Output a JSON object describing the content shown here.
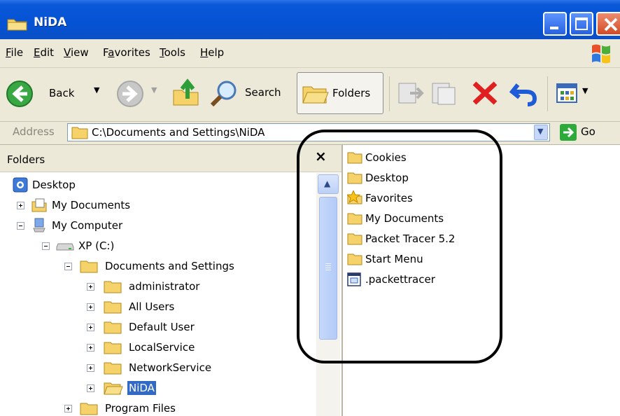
{
  "window": {
    "title": "NiDA"
  },
  "menu": {
    "items": [
      {
        "label": "File",
        "u": "F",
        "rest": "ile"
      },
      {
        "label": "Edit",
        "u": "E",
        "rest": "dit"
      },
      {
        "label": "View",
        "u": "V",
        "rest": "iew"
      },
      {
        "label": "Favorites",
        "pre": "F",
        "u": "a",
        "rest": "vorites"
      },
      {
        "label": "Tools",
        "u": "T",
        "rest": "ools"
      },
      {
        "label": "Help",
        "u": "H",
        "rest": "elp"
      }
    ]
  },
  "toolbar": {
    "back_label": "Back",
    "search_label": "Search",
    "folders_label": "Folders"
  },
  "address": {
    "label": "Address",
    "value": "C:\\Documents and Settings\\NiDA",
    "go_label": "Go"
  },
  "folders_pane": {
    "title": "Folders",
    "close_glyph": "×",
    "tree": [
      {
        "label": "Desktop",
        "icon": "desktop-icon"
      },
      {
        "label": "My Documents",
        "icon": "my-documents-icon",
        "expander": "plus"
      },
      {
        "label": "My Computer",
        "icon": "my-computer-icon",
        "expander": "minus"
      },
      {
        "label": "XP (C:)",
        "icon": "drive-icon",
        "expander": "minus"
      },
      {
        "label": "Documents and Settings",
        "icon": "folder-icon",
        "expander": "minus"
      },
      {
        "label": "administrator",
        "icon": "folder-icon",
        "expander": "plus"
      },
      {
        "label": "All Users",
        "icon": "folder-icon",
        "expander": "plus"
      },
      {
        "label": "Default User",
        "icon": "folder-icon",
        "expander": "plus"
      },
      {
        "label": "LocalService",
        "icon": "folder-icon",
        "expander": "plus"
      },
      {
        "label": "NetworkService",
        "icon": "folder-icon",
        "expander": "plus"
      },
      {
        "label": "NiDA",
        "icon": "open-folder-icon",
        "expander": "plus",
        "selected": true
      },
      {
        "label": "Program Files",
        "icon": "folder-icon",
        "expander": "plus"
      }
    ]
  },
  "content": {
    "files": [
      {
        "label": "Cookies",
        "icon": "folder-icon"
      },
      {
        "label": "Desktop",
        "icon": "folder-icon"
      },
      {
        "label": "Favorites",
        "icon": "favorites-star-icon"
      },
      {
        "label": "My Documents",
        "icon": "folder-icon"
      },
      {
        "label": "Packet Tracer 5.2",
        "icon": "folder-icon"
      },
      {
        "label": "Start Menu",
        "icon": "folder-icon"
      },
      {
        "label": ".packettracer",
        "icon": "file-icon"
      }
    ]
  },
  "colors": {
    "titlebar": "#0453d4",
    "chrome": "#ece9d8",
    "selection": "#316ac5",
    "folder_yellow": "#f5d36a"
  }
}
